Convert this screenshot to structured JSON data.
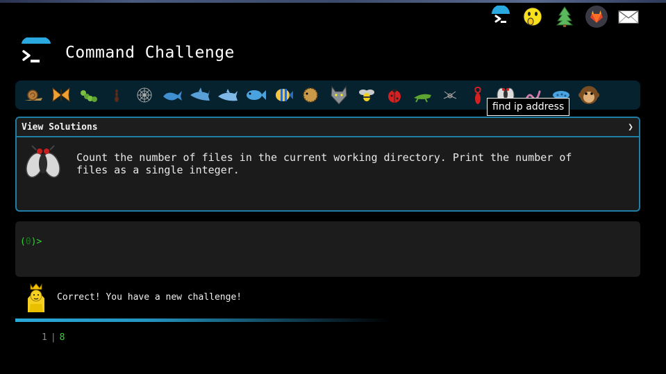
{
  "app": {
    "title": "Command Challenge"
  },
  "top_nav": [
    {
      "icon": "terminal-icon"
    },
    {
      "icon": "shush-face-icon"
    },
    {
      "icon": "tree-icon"
    },
    {
      "icon": "gitlab-icon"
    },
    {
      "icon": "mail-icon"
    }
  ],
  "animal_bar": {
    "items": [
      "snail-icon",
      "butterfly-icon",
      "caterpillar-icon",
      "ant-icon",
      "spiderweb-icon",
      "whale-icon",
      "shark-icon",
      "dolphin-icon",
      "fish-icon",
      "tropical-fish-icon",
      "blowfish-icon",
      "wolf-icon",
      "bee-icon",
      "ladybug-icon",
      "cricket-icon",
      "spider-icon",
      "scorpion-icon",
      "fly-icon",
      "worm-icon",
      "microbe-icon",
      "monkey-icon"
    ],
    "tooltip": "find ip address"
  },
  "challenge": {
    "header": "View Solutions",
    "chevron": "❯",
    "icon": "fly-icon",
    "text": "Count the number of files in the current working directory. Print the number of files as a single integer."
  },
  "terminal": {
    "prompt_open": "(",
    "prompt_count": "0",
    "prompt_close": ")>"
  },
  "result": {
    "icon": "princess-icon",
    "message": "Correct! You have a new challenge!"
  },
  "progress": 0.58,
  "output": {
    "line_number": "1",
    "separator": "|",
    "value": "8"
  },
  "colors": {
    "accent": "#1f7fa6",
    "prompt": "#33d633",
    "bar_background": "#06222e"
  }
}
